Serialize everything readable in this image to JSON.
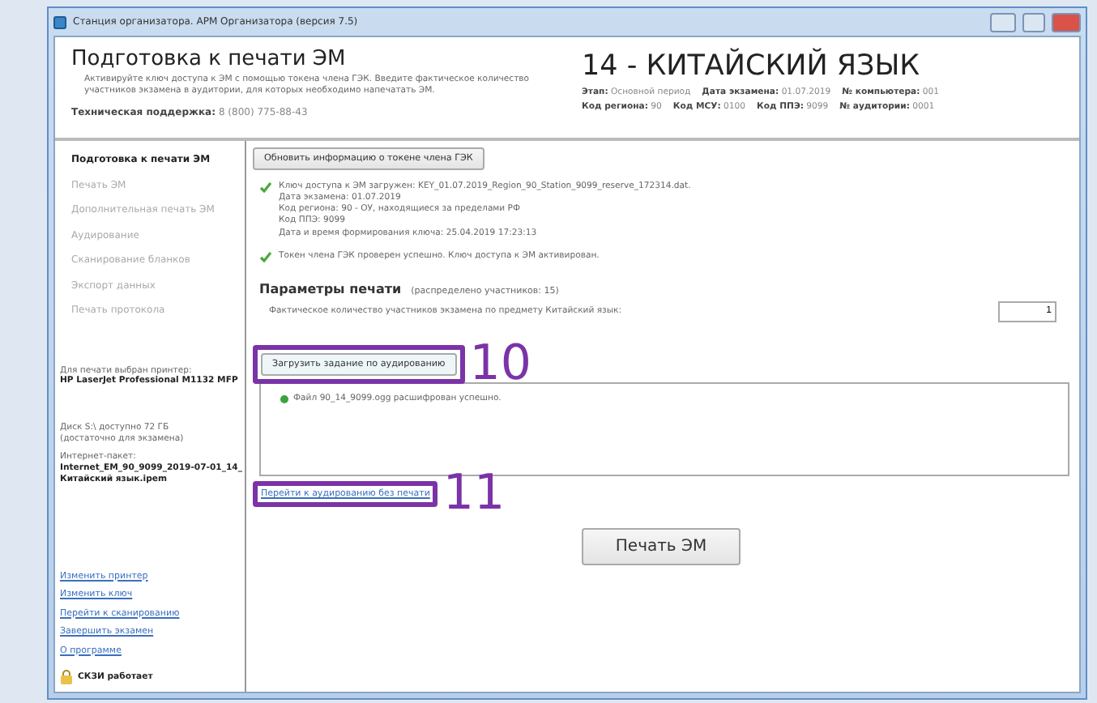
{
  "window": {
    "title": "Станция организатора. АРМ Организатора (версия 7.5)"
  },
  "header": {
    "title": "Подготовка к печати ЭМ",
    "description": "Активируйте ключ доступа к ЭМ с помощью токена члена ГЭК. Введите фактическое количество участников экзамена в аудитории, для которых необходимо напечатать ЭМ.",
    "support_label": "Техническая поддержка:",
    "support_phone": "8 (800) 775-88-43"
  },
  "exam": {
    "title": "14 - КИТАЙСКИЙ ЯЗЫК",
    "meta_rows": [
      [
        {
          "label": "Этап:",
          "value": "Основной период"
        },
        {
          "label": "Дата экзамена:",
          "value": "01.07.2019"
        },
        {
          "label": "№ компьютера:",
          "value": "001"
        }
      ],
      [
        {
          "label": "Код региона:",
          "value": "90"
        },
        {
          "label": "Код МСУ:",
          "value": "0100"
        },
        {
          "label": "Код ППЭ:",
          "value": "9099"
        },
        {
          "label": "№ аудитории:",
          "value": "0001"
        }
      ]
    ]
  },
  "sidebar": {
    "nav": [
      {
        "label": "Подготовка к печати ЭМ",
        "selected": true
      },
      {
        "label": "Печать ЭМ",
        "selected": false
      },
      {
        "label": "Дополнительная печать ЭМ",
        "selected": false
      },
      {
        "label": "Аудирование",
        "selected": false
      },
      {
        "label": "Сканирование бланков",
        "selected": false
      },
      {
        "label": "Экспорт данных",
        "selected": false
      },
      {
        "label": "Печать протокола",
        "selected": false
      }
    ],
    "printer_label": "Для печати выбран принтер:",
    "printer_name": "HP LaserJet Professional M1132 MFP",
    "disk_lines": [
      "Диск S:\\ доступно 72 ГБ",
      "(достаточно для экзамена)"
    ],
    "package_label": "Интернет-пакет:",
    "package_name": "Internet_EM_90_9099_2019-07-01_14_Китайский язык.ipem",
    "links": [
      "Изменить принтер",
      "Изменить ключ",
      "Перейти к сканированию",
      "Завершить экзамен",
      "О программе"
    ],
    "status": "СКЗИ работает"
  },
  "content": {
    "refresh_button": "Обновить информацию о токене члена ГЭК",
    "messages": [
      {
        "lines": [
          "Ключ доступа к ЭМ загружен: KEY_01.07.2019_Region_90_Station_9099_reserve_172314.dat.",
          "Дата экзамена: 01.07.2019",
          "Код региона: 90 - ОУ, находящиеся за пределами РФ",
          "Код ППЭ: 9099",
          "Дата и время формирования ключа: 25.04.2019 17:23:13"
        ]
      },
      {
        "lines": [
          "Токен члена ГЭК проверен успешно. Ключ доступа к ЭМ активирован."
        ]
      }
    ],
    "params_title": "Параметры печати",
    "params_note": "(распределено участников: 15)",
    "count_label": "Фактическое количество участников экзамена по предмету Китайский язык:",
    "count_value": "1",
    "load_button": {
      "label": "Загрузить задание по аудированию",
      "callout": "10"
    },
    "log": [
      "Файл 90_14_9099.ogg расшифрован успешно."
    ],
    "audio_link": {
      "label": "Перейти к аудированию без печати",
      "callout": "11"
    },
    "print_button": "Печать ЭМ"
  }
}
